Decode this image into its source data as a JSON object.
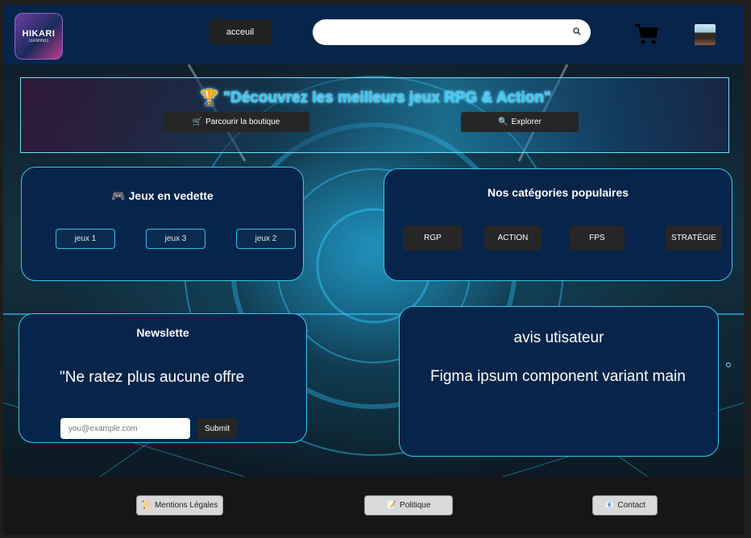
{
  "header": {
    "logo_line1": "HIKARI",
    "logo_line2": "GAMING",
    "home_label": "acceuil",
    "search_placeholder": "",
    "search_icon": "search-icon",
    "cart_icon": "cart-icon",
    "avatar_icon": "user-avatar"
  },
  "banner": {
    "trophy_icon": "🏆",
    "title": "\"Découvrez les meilleurs jeux RPG & Action\"",
    "shop_icon": "🛒",
    "shop_label": "Parcourir la boutique",
    "explore_icon": "🔍",
    "explore_label": "Explorer"
  },
  "featured": {
    "icon": "🎮",
    "title": "Jeux en vedette",
    "games": [
      "jeux 1",
      "jeux 3",
      "jeux 2"
    ]
  },
  "categories": {
    "title": "Nos catégories populaires",
    "items": [
      "RGP",
      "ACTION",
      "FPS",
      "STRATÉGIE"
    ]
  },
  "newsletter": {
    "title": "Newslette",
    "text": "\"Ne ratez plus aucune offre",
    "email_placeholder": "you@example.com",
    "submit_label": "Submit"
  },
  "reviews": {
    "title": "avis utisateur",
    "body": "Figma ipsum component variant main"
  },
  "footer": {
    "legal_icon": "📜",
    "legal_label": "Mentions Légales",
    "policy_icon": "📝",
    "policy_label": "Politique",
    "contact_icon": "📧",
    "contact_label": "Contact"
  },
  "colors": {
    "header_bg": "#07254a",
    "card_border": "#34c8ee",
    "button_dark": "#262626",
    "footer_bg": "#161616"
  }
}
